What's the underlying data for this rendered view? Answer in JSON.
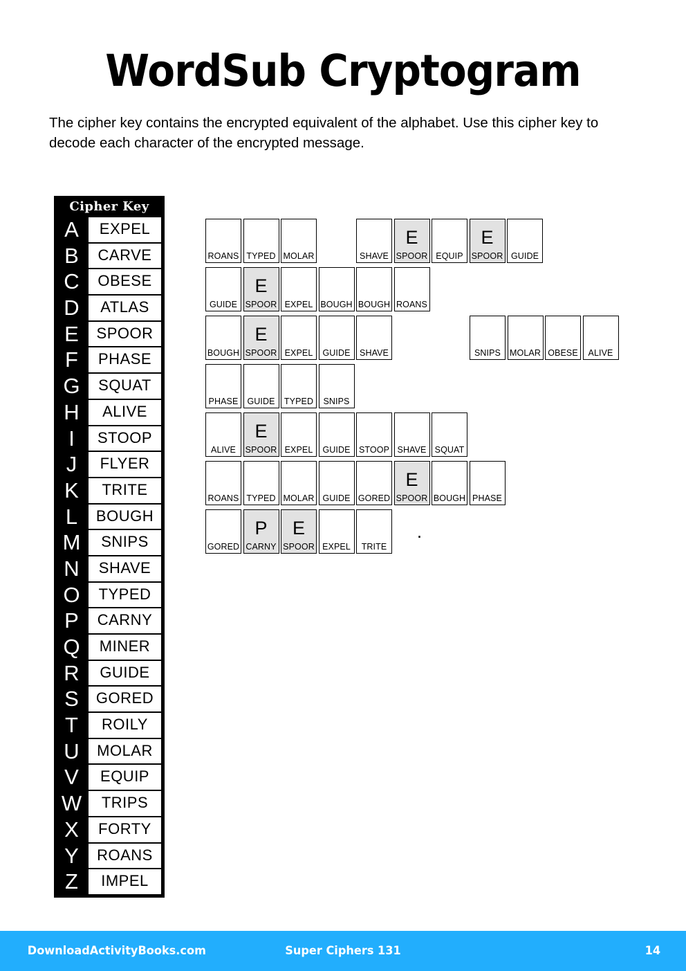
{
  "page_title": "WordSub Cryptogram",
  "instructions": "The cipher key contains the encrypted equivalent of the alphabet. Use this cipher key to decode each character of the encrypted message.",
  "cipher_key": {
    "header": "Cipher Key",
    "entries": [
      {
        "letter": "A",
        "word": "EXPEL"
      },
      {
        "letter": "B",
        "word": "CARVE"
      },
      {
        "letter": "C",
        "word": "OBESE"
      },
      {
        "letter": "D",
        "word": "ATLAS"
      },
      {
        "letter": "E",
        "word": "SPOOR"
      },
      {
        "letter": "F",
        "word": "PHASE"
      },
      {
        "letter": "G",
        "word": "SQUAT"
      },
      {
        "letter": "H",
        "word": "ALIVE"
      },
      {
        "letter": "I",
        "word": "STOOP"
      },
      {
        "letter": "J",
        "word": "FLYER"
      },
      {
        "letter": "K",
        "word": "TRITE"
      },
      {
        "letter": "L",
        "word": "BOUGH"
      },
      {
        "letter": "M",
        "word": "SNIPS"
      },
      {
        "letter": "N",
        "word": "SHAVE"
      },
      {
        "letter": "O",
        "word": "TYPED"
      },
      {
        "letter": "P",
        "word": "CARNY"
      },
      {
        "letter": "Q",
        "word": "MINER"
      },
      {
        "letter": "R",
        "word": "GUIDE"
      },
      {
        "letter": "S",
        "word": "GORED"
      },
      {
        "letter": "T",
        "word": "ROILY"
      },
      {
        "letter": "U",
        "word": "MOLAR"
      },
      {
        "letter": "V",
        "word": "EQUIP"
      },
      {
        "letter": "W",
        "word": "TRIPS"
      },
      {
        "letter": "X",
        "word": "FORTY"
      },
      {
        "letter": "Y",
        "word": "ROANS"
      },
      {
        "letter": "Z",
        "word": "IMPEL"
      }
    ]
  },
  "puzzle": {
    "rows": [
      {
        "cells": [
          {
            "type": "cell",
            "code": "ROANS",
            "answer": "",
            "shaded": false
          },
          {
            "type": "cell",
            "code": "TYPED",
            "answer": "",
            "shaded": false
          },
          {
            "type": "cell",
            "code": "MOLAR",
            "answer": "",
            "shaded": false
          },
          {
            "type": "gap",
            "size": 1
          },
          {
            "type": "cell",
            "code": "SHAVE",
            "answer": "",
            "shaded": false
          },
          {
            "type": "cell",
            "code": "SPOOR",
            "answer": "E",
            "shaded": true
          },
          {
            "type": "cell",
            "code": "EQUIP",
            "answer": "",
            "shaded": false
          },
          {
            "type": "cell",
            "code": "SPOOR",
            "answer": "E",
            "shaded": true
          },
          {
            "type": "cell",
            "code": "GUIDE",
            "answer": "",
            "shaded": false
          }
        ]
      },
      {
        "cells": [
          {
            "type": "cell",
            "code": "GUIDE",
            "answer": "",
            "shaded": false
          },
          {
            "type": "cell",
            "code": "SPOOR",
            "answer": "E",
            "shaded": true
          },
          {
            "type": "cell",
            "code": "EXPEL",
            "answer": "",
            "shaded": false
          },
          {
            "type": "cell",
            "code": "BOUGH",
            "answer": "",
            "shaded": false
          },
          {
            "type": "cell",
            "code": "BOUGH",
            "answer": "",
            "shaded": false
          },
          {
            "type": "cell",
            "code": "ROANS",
            "answer": "",
            "shaded": false
          }
        ]
      },
      {
        "cells": [
          {
            "type": "cell",
            "code": "BOUGH",
            "answer": "",
            "shaded": false
          },
          {
            "type": "cell",
            "code": "SPOOR",
            "answer": "E",
            "shaded": true
          },
          {
            "type": "cell",
            "code": "EXPEL",
            "answer": "",
            "shaded": false
          },
          {
            "type": "cell",
            "code": "GUIDE",
            "answer": "",
            "shaded": false
          },
          {
            "type": "cell",
            "code": "SHAVE",
            "answer": "",
            "shaded": false
          },
          {
            "type": "gap",
            "size": 2
          },
          {
            "type": "cell",
            "code": "SNIPS",
            "answer": "",
            "shaded": false
          },
          {
            "type": "cell",
            "code": "MOLAR",
            "answer": "",
            "shaded": false
          },
          {
            "type": "cell",
            "code": "OBESE",
            "answer": "",
            "shaded": false
          },
          {
            "type": "cell",
            "code": "ALIVE",
            "answer": "",
            "shaded": false
          }
        ]
      },
      {
        "cells": [
          {
            "type": "cell",
            "code": "PHASE",
            "answer": "",
            "shaded": false
          },
          {
            "type": "cell",
            "code": "GUIDE",
            "answer": "",
            "shaded": false
          },
          {
            "type": "cell",
            "code": "TYPED",
            "answer": "",
            "shaded": false
          },
          {
            "type": "cell",
            "code": "SNIPS",
            "answer": "",
            "shaded": false
          }
        ]
      },
      {
        "cells": [
          {
            "type": "cell",
            "code": "ALIVE",
            "answer": "",
            "shaded": false
          },
          {
            "type": "cell",
            "code": "SPOOR",
            "answer": "E",
            "shaded": true
          },
          {
            "type": "cell",
            "code": "EXPEL",
            "answer": "",
            "shaded": false
          },
          {
            "type": "cell",
            "code": "GUIDE",
            "answer": "",
            "shaded": false
          },
          {
            "type": "cell",
            "code": "STOOP",
            "answer": "",
            "shaded": false
          },
          {
            "type": "cell",
            "code": "SHAVE",
            "answer": "",
            "shaded": false
          },
          {
            "type": "cell",
            "code": "SQUAT",
            "answer": "",
            "shaded": false
          }
        ]
      },
      {
        "cells": [
          {
            "type": "cell",
            "code": "ROANS",
            "answer": "",
            "shaded": false
          },
          {
            "type": "cell",
            "code": "TYPED",
            "answer": "",
            "shaded": false
          },
          {
            "type": "cell",
            "code": "MOLAR",
            "answer": "",
            "shaded": false
          },
          {
            "type": "cell",
            "code": "GUIDE",
            "answer": "",
            "shaded": false
          },
          {
            "type": "cell",
            "code": "GORED",
            "answer": "",
            "shaded": false
          },
          {
            "type": "cell",
            "code": "SPOOR",
            "answer": "E",
            "shaded": true
          },
          {
            "type": "cell",
            "code": "BOUGH",
            "answer": "",
            "shaded": false
          },
          {
            "type": "cell",
            "code": "PHASE",
            "answer": "",
            "shaded": false
          }
        ]
      },
      {
        "cells": [
          {
            "type": "cell",
            "code": "GORED",
            "answer": "",
            "shaded": false
          },
          {
            "type": "cell",
            "code": "CARNY",
            "answer": "P",
            "shaded": true
          },
          {
            "type": "cell",
            "code": "SPOOR",
            "answer": "E",
            "shaded": true
          },
          {
            "type": "cell",
            "code": "EXPEL",
            "answer": "",
            "shaded": false
          },
          {
            "type": "cell",
            "code": "TRITE",
            "answer": "",
            "shaded": false
          },
          {
            "type": "period",
            "text": "."
          }
        ]
      }
    ]
  },
  "footer": {
    "website": "DownloadActivityBooks.com",
    "book_title": "Super Ciphers 131",
    "page_number": "14",
    "background_color": "#22aefd"
  }
}
